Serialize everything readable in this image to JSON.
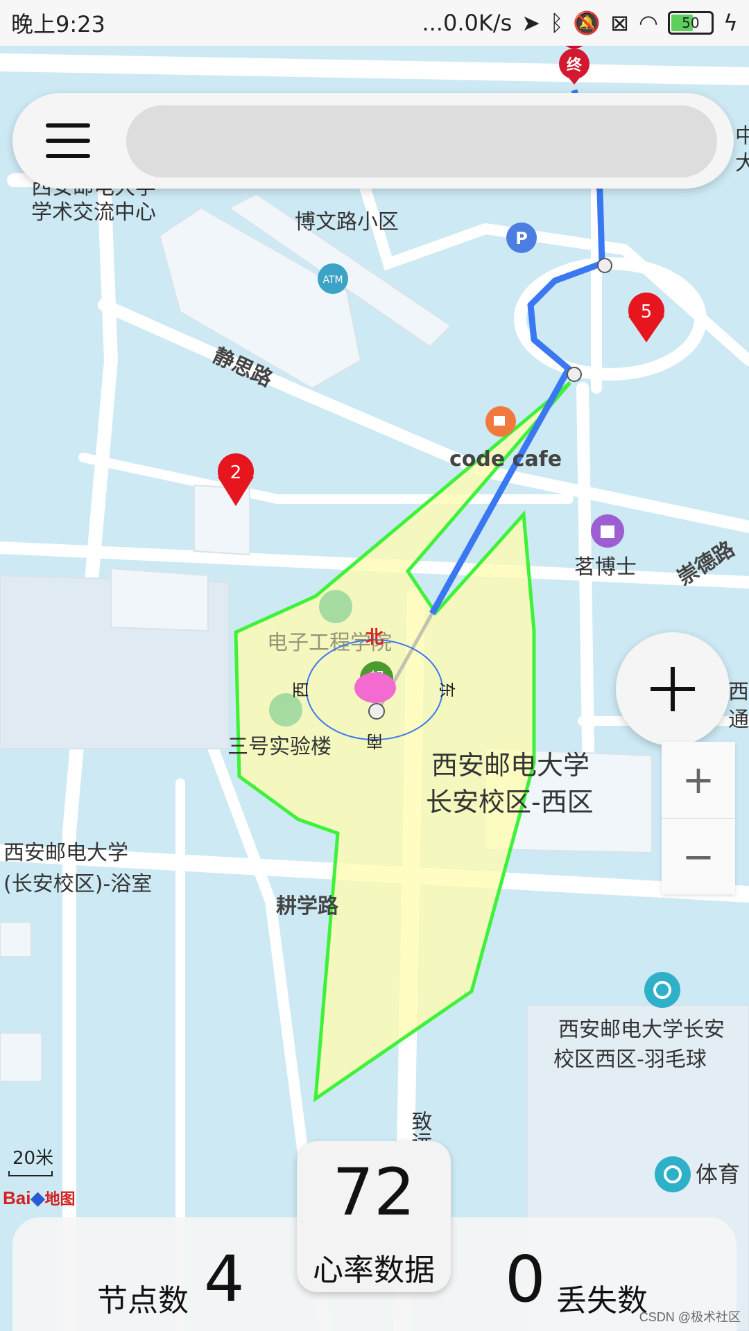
{
  "status_bar": {
    "time": "晚上9:23",
    "network_speed": "...0.0K/s",
    "battery_level": "50"
  },
  "search": {
    "placeholder": ""
  },
  "map": {
    "labels": {
      "xiyou_academic": "西安邮电大学",
      "xiyou_academic_2": "学术交流中心",
      "bowen_road": "博文路小区",
      "jingsi_road": "静思路",
      "code_cafe": "code cafe",
      "mingboshi": "茗博士",
      "chongde_road": "崇德路",
      "ee_college": "电子工程学院",
      "lab_building3": "三号实验楼",
      "campus_west_1": "西安邮电大学",
      "campus_west_2": "长安校区-西区",
      "bathroom_1": "西安邮电大学",
      "bathroom_2": "(长安校区)-浴室",
      "gengxue_road": "耕学路",
      "badminton_1": "西安邮电大学长安",
      "badminton_2": "校区西区-羽毛球",
      "zhiyuan": "致远",
      "gym": "体育",
      "right_edge_top": "中",
      "right_edge_top2": "大",
      "right_edge_mid": "西",
      "right_edge_mid2": "通",
      "atm": "ATM",
      "parking": "P"
    },
    "markers": {
      "end": "终",
      "start": "起",
      "m2": "2",
      "m5": "5"
    },
    "compass": {
      "north": "北",
      "south": "南",
      "east": "东",
      "west": "西"
    },
    "scale": "20米",
    "logo": "Bai",
    "logo_cn": "地图"
  },
  "controls": {
    "fab_icon": "plus-icon",
    "zoom_in": "+",
    "zoom_out": "−"
  },
  "bottom": {
    "heart_rate_value": "72",
    "heart_rate_label": "心率数据",
    "node_count_label": "节点数",
    "node_count_value": "4",
    "lost_count_value": "0",
    "lost_count_label": "丢失数"
  },
  "watermark": "CSDN @极术社区",
  "colors": {
    "route": "#3a78f2",
    "polygon_fill": "#fffcb0",
    "polygon_stroke": "#3ef23a",
    "map_bg": "#cde9f4"
  }
}
